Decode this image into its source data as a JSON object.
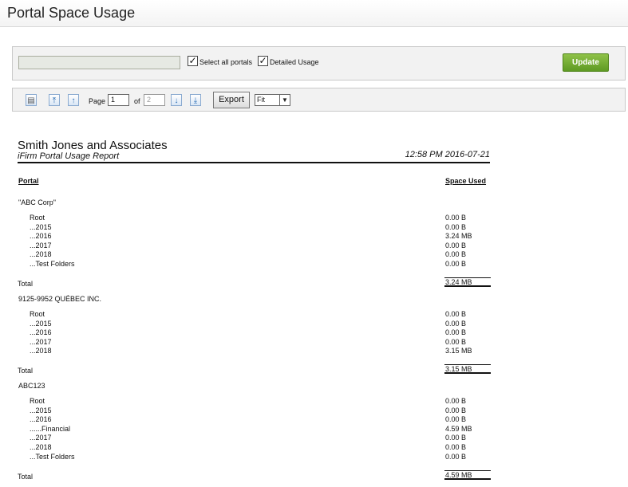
{
  "page": {
    "title": "Portal Space Usage"
  },
  "filters": {
    "portal_value": "",
    "select_all_label": "Select all portals",
    "select_all_checked": true,
    "detailed_label": "Detailed Usage",
    "detailed_checked": true,
    "update_label": "Update"
  },
  "toolbar": {
    "page_label": "Page",
    "page_value": "1",
    "of_label": "of",
    "total_pages": "2",
    "export_label": "Export",
    "zoom_value": "Fit",
    "icons": [
      "print-icon",
      "first-page-icon",
      "previous-page-icon",
      "next-page-icon",
      "last-page-icon"
    ]
  },
  "report": {
    "company": "Smith Jones and Associates",
    "subtitle": "iFirm Portal Usage Report",
    "datetime": "12:58 PM 2016-07-21",
    "col_portal": "Portal",
    "col_space": "Space Used",
    "total_label": "Total",
    "groups": [
      {
        "name": "\"ABC Corp\"",
        "rows": [
          {
            "name": "Root",
            "size": "0.00 B"
          },
          {
            "name": "...2015",
            "size": "0.00 B"
          },
          {
            "name": "...2016",
            "size": "3.24 MB"
          },
          {
            "name": "...2017",
            "size": "0.00 B"
          },
          {
            "name": "...2018",
            "size": "0.00 B"
          },
          {
            "name": "...Test Folders",
            "size": "0.00 B"
          }
        ],
        "total": "3.24 MB"
      },
      {
        "name": "9125-9952 QUÉBEC INC.",
        "rows": [
          {
            "name": "Root",
            "size": "0.00 B"
          },
          {
            "name": "...2015",
            "size": "0.00 B"
          },
          {
            "name": "...2016",
            "size": "0.00 B"
          },
          {
            "name": "...2017",
            "size": "0.00 B"
          },
          {
            "name": "...2018",
            "size": "3.15 MB"
          }
        ],
        "total": "3.15 MB"
      },
      {
        "name": "ABC123",
        "rows": [
          {
            "name": "Root",
            "size": "0.00 B"
          },
          {
            "name": "...2015",
            "size": "0.00 B"
          },
          {
            "name": "...2016",
            "size": "0.00 B"
          },
          {
            "name": "......Financial",
            "size": "4.59 MB"
          },
          {
            "name": "...2017",
            "size": "0.00 B"
          },
          {
            "name": "...2018",
            "size": "0.00 B"
          },
          {
            "name": "...Test Folders",
            "size": "0.00 B"
          }
        ],
        "total": "4.59 MB"
      }
    ]
  }
}
